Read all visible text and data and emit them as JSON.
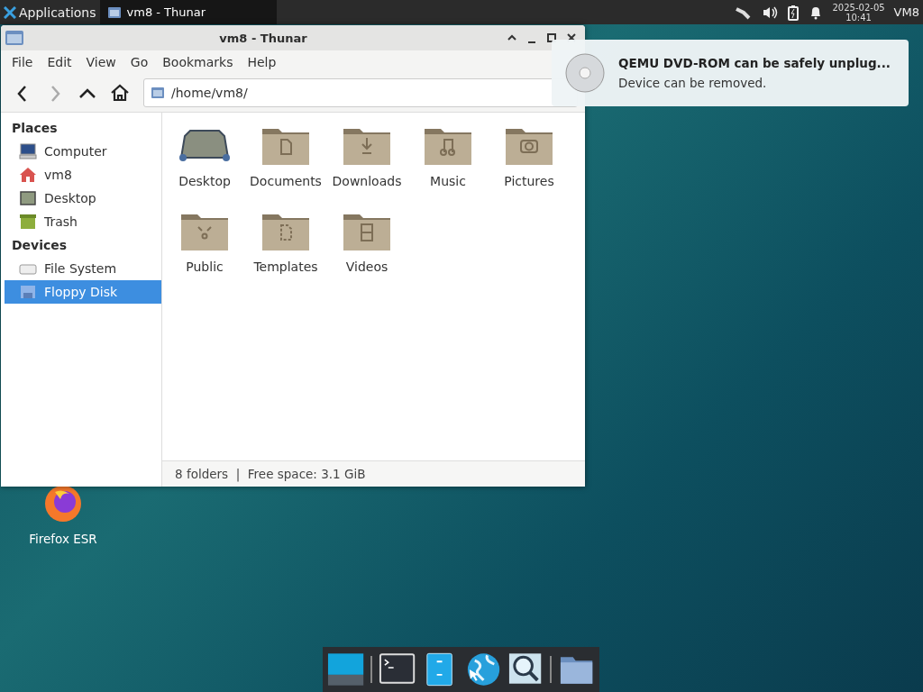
{
  "panel": {
    "menu": "Applications",
    "tasks": [
      {
        "title": "vm8 - Thunar",
        "selected": true
      }
    ],
    "date": "2025-02-05",
    "time": "10:41",
    "user": "VM8"
  },
  "window": {
    "title": "vm8 - Thunar",
    "menu": [
      "File",
      "Edit",
      "View",
      "Go",
      "Bookmarks",
      "Help"
    ],
    "toolbar": [
      {
        "kind": "back",
        "disabled": false
      },
      {
        "kind": "forward",
        "disabled": true
      },
      {
        "kind": "up",
        "disabled": false
      },
      {
        "kind": "home",
        "disabled": false
      }
    ],
    "location": "/home/vm8/",
    "sidebar": [
      {
        "heading": "Places",
        "items": [
          {
            "label": "Computer",
            "kind": "computer",
            "selected": false
          },
          {
            "label": "vm8",
            "kind": "home",
            "selected": false
          },
          {
            "label": "Desktop",
            "kind": "desktop",
            "selected": false
          },
          {
            "label": "Trash",
            "kind": "trash",
            "selected": false
          }
        ]
      },
      {
        "heading": "Devices",
        "items": [
          {
            "label": "File System",
            "kind": "drive",
            "selected": false
          },
          {
            "label": "Floppy Disk",
            "kind": "floppy",
            "selected": true
          }
        ]
      }
    ],
    "files": [
      {
        "name": "Desktop",
        "kind": "desktop"
      },
      {
        "name": "Documents",
        "kind": "documents"
      },
      {
        "name": "Downloads",
        "kind": "downloads"
      },
      {
        "name": "Music",
        "kind": "music"
      },
      {
        "name": "Pictures",
        "kind": "pictures"
      },
      {
        "name": "Public",
        "kind": "public"
      },
      {
        "name": "Templates",
        "kind": "templates"
      },
      {
        "name": "Videos",
        "kind": "videos"
      }
    ],
    "status": "8 folders  |  Free space: 3.1 GiB"
  },
  "notification": {
    "title": "QEMU DVD-ROM can be safely unplug...",
    "body": "Device can be removed."
  },
  "desktop_icons": [
    {
      "label": "Firefox ESR"
    }
  ],
  "dock": [
    {
      "kind": "show-desktop"
    },
    {
      "kind": "terminal"
    },
    {
      "kind": "file-manager"
    },
    {
      "kind": "browser"
    },
    {
      "kind": "search"
    },
    {
      "kind": "folder"
    }
  ]
}
